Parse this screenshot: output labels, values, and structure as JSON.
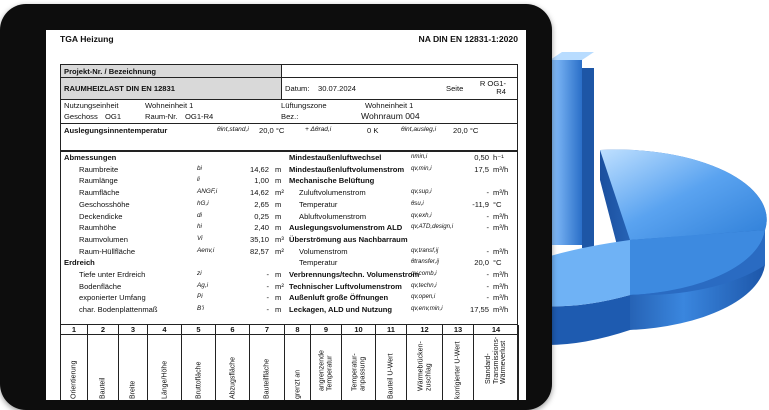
{
  "header": {
    "company": "TGA Heizung",
    "standard": "NA DIN EN 12831-1:2020"
  },
  "project": {
    "label": "Projekt-Nr. / Bezeichnung"
  },
  "title_row": {
    "title": "RAUMHEIZLAST DIN EN 12831",
    "date_label": "Datum:",
    "date": "30.07.2024",
    "page_label": "Seite",
    "page_value": "R OG1-R4"
  },
  "info": {
    "unit_label": "Nutzungseinheit",
    "unit_value": "Wohneinheit 1",
    "zone_label": "Lüftungszone",
    "zone_value": "Wohneinheit 1",
    "floor_label": "Geschoss",
    "floor_value": "OG1",
    "room_no_label": "Raum-Nr.",
    "room_no_value": "OG1-R4",
    "desc_label": "Bez.:",
    "desc_value": "Wohnraum 004"
  },
  "design_temp": {
    "label": "Auslegungsinnentemperatur",
    "s1": "θint,stand,i",
    "v1": "20,0 °C",
    "s2": "+ Δθrad,i",
    "v2": "0 K",
    "s3": "θint,ausleg,i",
    "v3": "20,0 °C"
  },
  "left_rows": [
    {
      "label": "Abmessungen",
      "sym": "",
      "val": "",
      "unit": "",
      "bold": true
    },
    {
      "label": "Raumbreite",
      "sym": "bi",
      "val": "14,62",
      "unit": "m"
    },
    {
      "label": "Raumlänge",
      "sym": "li",
      "val": "1,00",
      "unit": "m"
    },
    {
      "label": "Raumfläche",
      "sym": "ANGF,i",
      "val": "14,62",
      "unit": "m²"
    },
    {
      "label": "Geschosshöhe",
      "sym": "hG,i",
      "val": "2,65",
      "unit": "m"
    },
    {
      "label": "Deckendicke",
      "sym": "di",
      "val": "0,25",
      "unit": "m"
    },
    {
      "label": "Raumhöhe",
      "sym": "hi",
      "val": "2,40",
      "unit": "m"
    },
    {
      "label": "Raumvolumen",
      "sym": "Vi",
      "val": "35,10",
      "unit": "m³"
    },
    {
      "label": "Raum-Hüllfläche",
      "sym": "Aenv,i",
      "val": "82,57",
      "unit": "m²"
    },
    {
      "label": "Erdreich",
      "sym": "",
      "val": "",
      "unit": "",
      "bold": true
    },
    {
      "label": "Tiefe unter Erdreich",
      "sym": "zi",
      "val": "-",
      "unit": "m"
    },
    {
      "label": "Bodenfläche",
      "sym": "Ag,i",
      "val": "-",
      "unit": "m²"
    },
    {
      "label": "exponierter Umfang",
      "sym": "Pi",
      "val": "-",
      "unit": "m"
    },
    {
      "label": "char. Bodenplattenmaß",
      "sym": "B'i",
      "val": "-",
      "unit": "m"
    }
  ],
  "right_rows": [
    {
      "label": "Mindestaußenluftwechsel",
      "sym": "nmin,i",
      "val": "0,50",
      "unit": "h⁻¹",
      "bold": true
    },
    {
      "label": "Mindestaußenluftvolumenstrom",
      "sym": "qv,min,i",
      "val": "17,5",
      "unit": "m³/h",
      "bold": true
    },
    {
      "label": "Mechanische Belüftung",
      "sym": "",
      "val": "",
      "unit": "",
      "bold": true
    },
    {
      "label": "Zuluftvolumenstrom",
      "sym": "qv,sup,i",
      "val": "-",
      "unit": "m³/h"
    },
    {
      "label": "Temperatur",
      "sym": "θsu,i",
      "val": "-11,9",
      "unit": "°C"
    },
    {
      "label": "Abluftvolumenstrom",
      "sym": "qv,exh,i",
      "val": "-",
      "unit": "m³/h"
    },
    {
      "label": "Auslegungsvolumenstrom ALD",
      "sym": "qv,ATD,design,i",
      "val": "-",
      "unit": "m³/h",
      "bold": true
    },
    {
      "label": "Überströmung aus Nachbarraum",
      "sym": "",
      "val": "",
      "unit": "",
      "bold": true
    },
    {
      "label": "Volumenstrom",
      "sym": "qv,transf,ij",
      "val": "-",
      "unit": "m³/h"
    },
    {
      "label": "Temperatur",
      "sym": "θtransfer,ij",
      "val": "20,0",
      "unit": "°C"
    },
    {
      "label": "Verbrennungs/techn. Volumenstrom",
      "sym": "qv,comb,i",
      "val": "-",
      "unit": "m³/h",
      "bold": true
    },
    {
      "label": "Technischer Luftvolumenstrom",
      "sym": "qv,techn,i",
      "val": "-",
      "unit": "m³/h",
      "bold": true
    },
    {
      "label": "Außenluft große Öffnungen",
      "sym": "qv,open,i",
      "val": "-",
      "unit": "m³/h",
      "bold": true
    },
    {
      "label": "Leckagen, ALD und Nutzung",
      "sym": "qv,env,min,i",
      "val": "17,55",
      "unit": "m³/h",
      "bold": true
    }
  ],
  "columns": [
    {
      "num": "1",
      "head": "Orientierung"
    },
    {
      "num": "2",
      "head": "Bauteil"
    },
    {
      "num": "3",
      "head": "Breite"
    },
    {
      "num": "4",
      "head": "Länge/Höhe"
    },
    {
      "num": "5",
      "head": "Bruttofläche"
    },
    {
      "num": "6",
      "head": "Abzugsfläche"
    },
    {
      "num": "7",
      "head": "Bauteilfläche"
    },
    {
      "num": "8",
      "head": "grenzt an"
    },
    {
      "num": "9",
      "head": "angrenzende Temperatur"
    },
    {
      "num": "10",
      "head": "Temperatur-anpassung"
    },
    {
      "num": "11",
      "head": "Bauteil U-Wert"
    },
    {
      "num": "12",
      "head": "Wärmebrücken-zuschlag"
    },
    {
      "num": "13",
      "head": "korrigierter U-Wert"
    },
    {
      "num": "14",
      "head": "Standard-Transmissions-Wärmeverlust"
    }
  ],
  "colors": {
    "pie_blue": "#2f7fd8",
    "pie_dark": "#1b4f9e",
    "frame": "#0d0d0d"
  }
}
